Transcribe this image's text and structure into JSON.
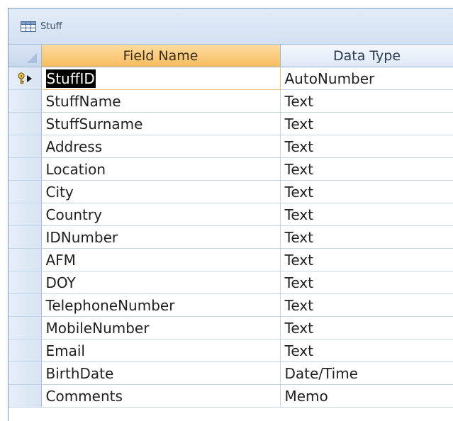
{
  "window": {
    "title": "Stuff",
    "icon": "datasheet-table-icon"
  },
  "grid": {
    "columns": [
      "Field Name",
      "Data Type"
    ],
    "rows": [
      {
        "field": "StuffID",
        "type": "AutoNumber",
        "primary_key": true,
        "current": true
      },
      {
        "field": "StuffName",
        "type": "Text"
      },
      {
        "field": "StuffSurname",
        "type": "Text"
      },
      {
        "field": "Address",
        "type": "Text"
      },
      {
        "field": "Location",
        "type": "Text"
      },
      {
        "field": "City",
        "type": "Text"
      },
      {
        "field": "Country",
        "type": "Text"
      },
      {
        "field": "IDNumber",
        "type": "Text"
      },
      {
        "field": "AFM",
        "type": "Text"
      },
      {
        "field": "DOY",
        "type": "Text"
      },
      {
        "field": "TelephoneNumber",
        "type": "Text"
      },
      {
        "field": "MobileNumber",
        "type": "Text"
      },
      {
        "field": "Email",
        "type": "Text"
      },
      {
        "field": "BirthDate",
        "type": "Date/Time"
      },
      {
        "field": "Comments",
        "type": "Memo"
      }
    ]
  },
  "colors": {
    "selected_header": "#f7bd5e",
    "border": "#9eb6ce",
    "selector_column": "#dbe6f4"
  }
}
